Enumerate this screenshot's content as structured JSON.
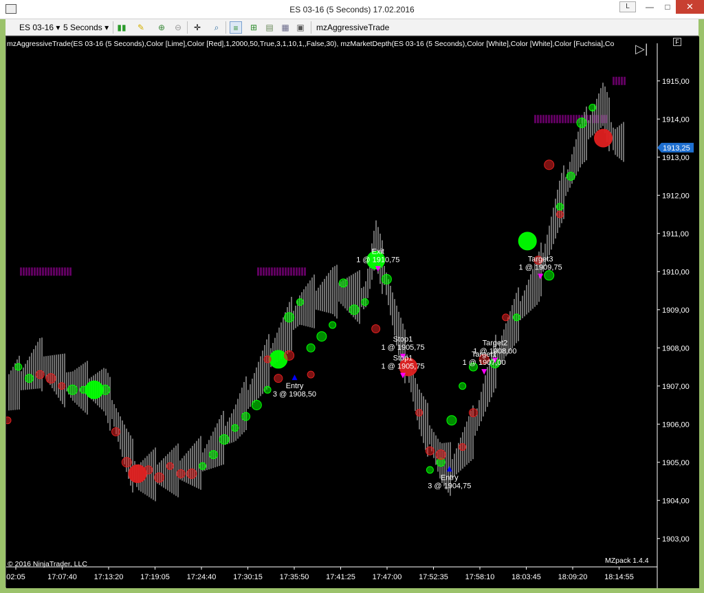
{
  "window": {
    "title": "ES 03-16 (5 Seconds)  17.02.2016",
    "l_button": "L",
    "minimize": "—",
    "maximize": "□",
    "close": "✕"
  },
  "toolbar": {
    "instrument": "ES 03-16",
    "interval": "5 Seconds",
    "indicator_name": "mzAggressiveTrade"
  },
  "chart_header": {
    "indicator_line": "mzAggressiveTrade(ES 03-16 (5 Seconds),Color [Lime],Color [Red],1,2000,50,True,3,1,10,1,,False,30), mzMarketDepth(ES 03-16 (5 Seconds),Color [White],Color [White],Color [Fuchsia],Co",
    "f_button": "F"
  },
  "footer": {
    "copyright": "© 2016 NinjaTrader, LLC",
    "version": "MZpack 1.4.4"
  },
  "price_axis": {
    "labels": [
      "1915,00",
      "1914,00",
      "1913,00",
      "1912,00",
      "1911,00",
      "1910,00",
      "1909,00",
      "1908,00",
      "1907,00",
      "1906,00",
      "1905,00",
      "1904,00",
      "1903,00"
    ],
    "current_price": "1913,25"
  },
  "time_axis": {
    "labels": [
      "02:05",
      "17:07:40",
      "17:13:20",
      "17:19:05",
      "17:24:40",
      "17:30:15",
      "17:35:50",
      "17:41:25",
      "17:47:00",
      "17:52:35",
      "17:58:10",
      "18:03:45",
      "18:09:20",
      "18:14:55"
    ]
  },
  "colors": {
    "buy": "#00ff00",
    "sell": "#e02020",
    "depth": "#800080",
    "signal": "#ff00ff",
    "entry_arrow": "#0000ff",
    "bars": "#8c8c8c",
    "price_marker": "#1e6fd0"
  },
  "chart_data": {
    "type": "scatter",
    "instrument": "ES 03-16",
    "interval": "5 Seconds",
    "ylim": [
      1902.5,
      1915.5
    ],
    "series": [
      {
        "name": "mzAggressiveTrade buy",
        "color": "#00ff00",
        "points": [
          [
            1,
            1907.5
          ],
          [
            2,
            1907.2
          ],
          [
            6,
            1906.9
          ],
          [
            7,
            1906.9
          ],
          [
            8,
            1906.9
          ],
          [
            9,
            1906.9
          ],
          [
            18,
            1904.9
          ],
          [
            19,
            1905.2
          ],
          [
            20,
            1905.6
          ],
          [
            21,
            1905.9
          ],
          [
            22,
            1906.2
          ],
          [
            23,
            1906.5
          ],
          [
            24,
            1906.9
          ],
          [
            25,
            1907.7
          ],
          [
            26,
            1908.8
          ],
          [
            27,
            1909.2
          ],
          [
            28,
            1908.0
          ],
          [
            29,
            1908.3
          ],
          [
            30,
            1908.6
          ],
          [
            31,
            1909.7
          ],
          [
            32,
            1909.0
          ],
          [
            33,
            1909.2
          ],
          [
            34,
            1910.3
          ],
          [
            35,
            1909.8
          ],
          [
            39,
            1904.8
          ],
          [
            40,
            1905.0
          ],
          [
            41,
            1906.1
          ],
          [
            42,
            1907.0
          ],
          [
            43,
            1907.5
          ],
          [
            45,
            1907.6
          ],
          [
            47,
            1908.8
          ],
          [
            48,
            1910.8
          ],
          [
            50,
            1909.9
          ],
          [
            51,
            1911.7
          ],
          [
            52,
            1912.5
          ],
          [
            53,
            1913.9
          ],
          [
            54,
            1914.3
          ]
        ]
      },
      {
        "name": "mzAggressiveTrade sell",
        "color": "#e02020",
        "points": [
          [
            0,
            1906.1
          ],
          [
            3,
            1907.3
          ],
          [
            4,
            1907.2
          ],
          [
            5,
            1907.0
          ],
          [
            10,
            1905.8
          ],
          [
            11,
            1905.0
          ],
          [
            12,
            1904.7
          ],
          [
            13,
            1904.8
          ],
          [
            14,
            1904.6
          ],
          [
            15,
            1904.9
          ],
          [
            16,
            1904.7
          ],
          [
            17,
            1904.7
          ],
          [
            24,
            1907.7
          ],
          [
            25,
            1907.2
          ],
          [
            26,
            1907.8
          ],
          [
            28,
            1907.3
          ],
          [
            34,
            1908.5
          ],
          [
            37,
            1907.5
          ],
          [
            38,
            1906.3
          ],
          [
            39,
            1905.3
          ],
          [
            40,
            1905.2
          ],
          [
            42,
            1905.4
          ],
          [
            43,
            1906.3
          ],
          [
            44,
            1907.7
          ],
          [
            46,
            1908.8
          ],
          [
            49,
            1910.3
          ],
          [
            50,
            1912.8
          ],
          [
            51,
            1911.5
          ],
          [
            55,
            1913.5
          ]
        ]
      }
    ],
    "annotations": [
      {
        "text": "Exit",
        "sub": "1 @ 1910,75"
      },
      {
        "text": "Entry",
        "sub": "3 @ 1908,50"
      },
      {
        "text": "Stop1",
        "sub": "1 @ 1905,75"
      },
      {
        "text": "Stop1",
        "sub": "1 @ 1905,75"
      },
      {
        "text": "Entry",
        "sub": "3 @ 1904,75"
      },
      {
        "text": "Target2",
        "sub": "1 @ 1908,00"
      },
      {
        "text": "Target1",
        "sub": "1 @ 1907,00"
      },
      {
        "text": "Target3",
        "sub": "1 @ 1909,75"
      }
    ]
  }
}
